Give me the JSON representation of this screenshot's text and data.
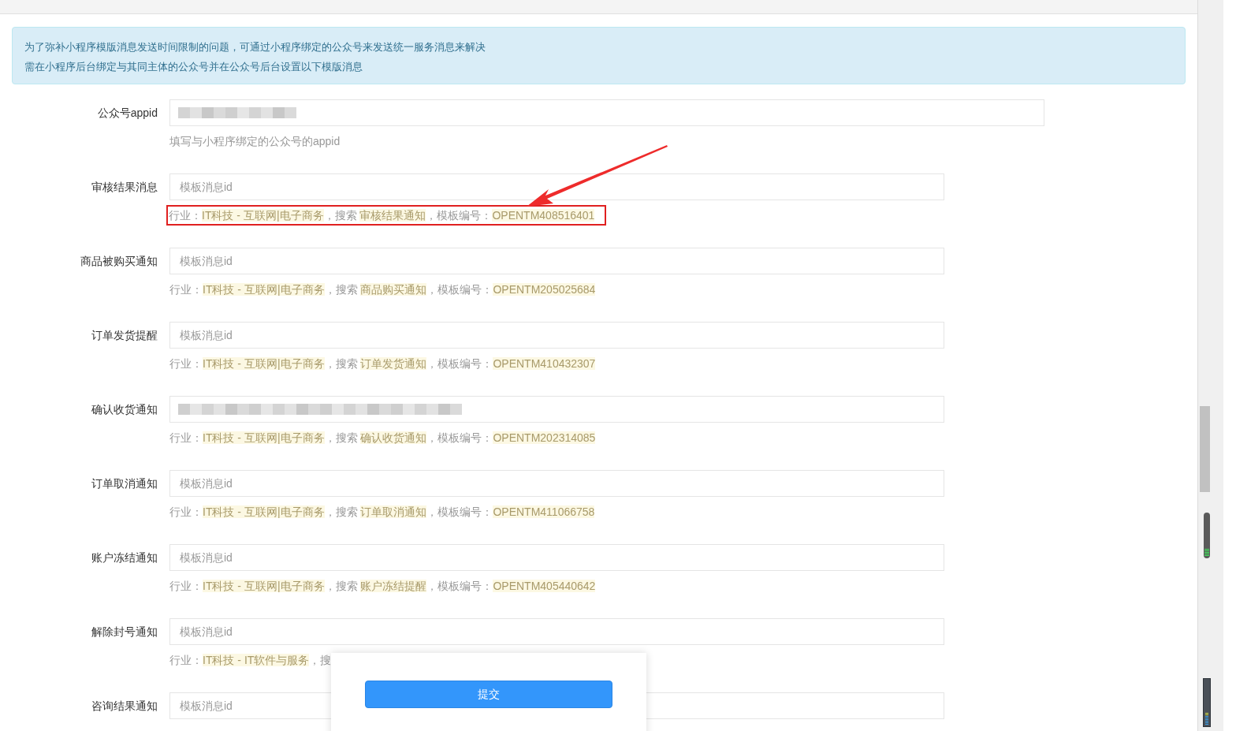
{
  "notice": {
    "lines": [
      "为了弥补小程序模版消息发送时间限制的问题，可通过小程序绑定的公众号来发送统一服务消息来解决",
      "需在小程序后台绑定与其同主体的公众号并在公众号后台设置以下模版消息"
    ]
  },
  "fields": [
    {
      "label": "公众号appid",
      "kind": "redacted",
      "wide": true,
      "annotated": false,
      "hint": [
        {
          "text": "填写与小程序绑定的公众号的appid",
          "highlight": false
        }
      ]
    },
    {
      "label": "审核结果消息",
      "kind": "empty",
      "placeholder": "模板消息id",
      "wide": false,
      "annotated": true,
      "hint": [
        {
          "text": "行业：",
          "highlight": false
        },
        {
          "text": "IT科技 - 互联网|电子商务",
          "highlight": true
        },
        {
          "text": "，搜索 ",
          "highlight": false
        },
        {
          "text": "审核结果通知",
          "highlight": true
        },
        {
          "text": "，模板编号：",
          "highlight": false
        },
        {
          "text": "OPENTM408516401",
          "highlight": true
        }
      ]
    },
    {
      "label": "商品被购买通知",
      "kind": "empty",
      "placeholder": "模板消息id",
      "wide": false,
      "annotated": false,
      "hint": [
        {
          "text": "行业：",
          "highlight": false
        },
        {
          "text": "IT科技 - 互联网|电子商务",
          "highlight": true
        },
        {
          "text": "，搜索 ",
          "highlight": false
        },
        {
          "text": "商品购买通知",
          "highlight": true
        },
        {
          "text": "，模板编号：",
          "highlight": false
        },
        {
          "text": "OPENTM205025684",
          "highlight": true
        }
      ]
    },
    {
      "label": "订单发货提醒",
      "kind": "empty",
      "placeholder": "模板消息id",
      "wide": false,
      "annotated": false,
      "hint": [
        {
          "text": "行业：",
          "highlight": false
        },
        {
          "text": "IT科技 - 互联网|电子商务",
          "highlight": true
        },
        {
          "text": "，搜索 ",
          "highlight": false
        },
        {
          "text": "订单发货通知",
          "highlight": true
        },
        {
          "text": "，模板编号：",
          "highlight": false
        },
        {
          "text": "OPENTM410432307",
          "highlight": true
        }
      ]
    },
    {
      "label": "确认收货通知",
      "kind": "redacted",
      "wide": false,
      "annotated": false,
      "hint": [
        {
          "text": "行业：",
          "highlight": false
        },
        {
          "text": "IT科技 - 互联网|电子商务",
          "highlight": true
        },
        {
          "text": "，搜索 ",
          "highlight": false
        },
        {
          "text": "确认收货通知",
          "highlight": true
        },
        {
          "text": "，模板编号：",
          "highlight": false
        },
        {
          "text": "OPENTM202314085",
          "highlight": true
        }
      ]
    },
    {
      "label": "订单取消通知",
      "kind": "empty",
      "placeholder": "模板消息id",
      "wide": false,
      "annotated": false,
      "hint": [
        {
          "text": "行业：",
          "highlight": false
        },
        {
          "text": "IT科技 - 互联网|电子商务",
          "highlight": true
        },
        {
          "text": "，搜索 ",
          "highlight": false
        },
        {
          "text": "订单取消通知",
          "highlight": true
        },
        {
          "text": "，模板编号：",
          "highlight": false
        },
        {
          "text": "OPENTM411066758",
          "highlight": true
        }
      ]
    },
    {
      "label": "账户冻结通知",
      "kind": "empty",
      "placeholder": "模板消息id",
      "wide": false,
      "annotated": false,
      "hint": [
        {
          "text": "行业：",
          "highlight": false
        },
        {
          "text": "IT科技 - 互联网|电子商务",
          "highlight": true
        },
        {
          "text": "，搜索 ",
          "highlight": false
        },
        {
          "text": "账户冻结提醒",
          "highlight": true
        },
        {
          "text": "，模板编号：",
          "highlight": false
        },
        {
          "text": "OPENTM405440642",
          "highlight": true
        }
      ]
    },
    {
      "label": "解除封号通知",
      "kind": "empty",
      "placeholder": "模板消息id",
      "wide": false,
      "annotated": false,
      "hint": [
        {
          "text": "行业：",
          "highlight": false
        },
        {
          "text": "IT科技 - IT软件与服务",
          "highlight": true
        },
        {
          "text": "，搜",
          "highlight": false
        }
      ]
    },
    {
      "label": "咨询结果通知",
      "kind": "empty",
      "placeholder": "模板消息id",
      "wide": false
    }
  ],
  "submit_button": "提交"
}
